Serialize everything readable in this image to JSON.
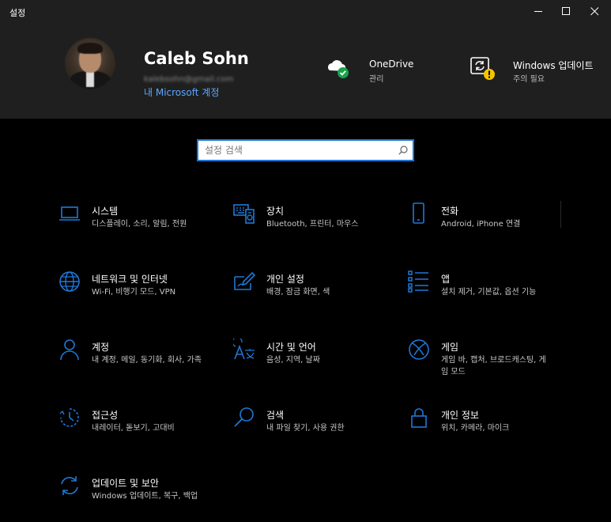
{
  "window": {
    "title": "설정"
  },
  "account": {
    "name": "Caleb Sohn",
    "email": "kalebsohn@gmail.com",
    "link": "내 Microsoft 계정"
  },
  "header_items": [
    {
      "title": "OneDrive",
      "subtitle": "관리"
    },
    {
      "title": "Windows 업데이트",
      "subtitle": "주의 필요"
    }
  ],
  "search": {
    "placeholder": "설정 검색"
  },
  "categories": [
    {
      "name": "시스템",
      "description": "디스플레이, 소리, 알림, 전원",
      "icon": "laptop-icon"
    },
    {
      "name": "장치",
      "description": "Bluetooth, 프린터, 마우스",
      "icon": "devices-icon"
    },
    {
      "name": "전화",
      "description": "Android, iPhone 연결",
      "icon": "phone-icon"
    },
    {
      "name": "네트워크 및 인터넷",
      "description": "Wi-Fi, 비행기 모드, VPN",
      "icon": "globe-icon"
    },
    {
      "name": "개인 설정",
      "description": "배경, 잠금 화면, 색",
      "icon": "paint-icon"
    },
    {
      "name": "앱",
      "description": "설치 제거, 기본값, 옵션 기능",
      "icon": "apps-list-icon"
    },
    {
      "name": "계정",
      "description": "내 계정, 메일, 동기화, 회사, 가족",
      "icon": "person-icon"
    },
    {
      "name": "시간 및 언어",
      "description": "음성, 지역, 날짜",
      "icon": "time-language-icon"
    },
    {
      "name": "게임",
      "description": "게임 바, 캡처, 브로드캐스팅, 게임 모드",
      "icon": "xbox-icon"
    },
    {
      "name": "접근성",
      "description": "내레이터, 돋보기, 고대비",
      "icon": "ease-of-access-icon"
    },
    {
      "name": "검색",
      "description": "내 파일 찾기, 사용 권한",
      "icon": "magnifier-icon"
    },
    {
      "name": "개인 정보",
      "description": "위치, 카메라, 마이크",
      "icon": "lock-icon"
    },
    {
      "name": "업데이트 및 보안",
      "description": "Windows 업데이트, 복구, 백업",
      "icon": "sync-icon"
    }
  ],
  "colors": {
    "accent": "#1e78d8",
    "link": "#5aa8ff",
    "success": "#16a34a",
    "warning": "#f5c400"
  }
}
